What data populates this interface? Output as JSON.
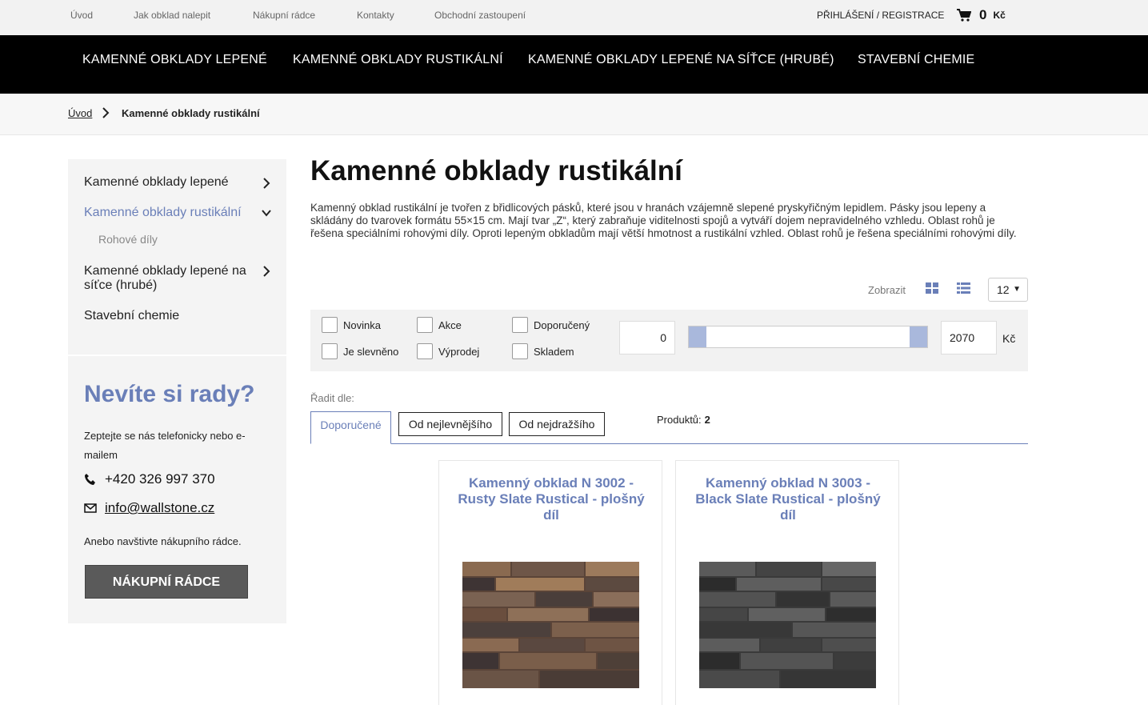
{
  "topbar": {
    "links": [
      "Úvod",
      "Jak obklad nalepit",
      "Nákupní rádce",
      "Kontakty",
      "Obchodní zastoupení"
    ],
    "login": "PŘIHLÁŠENÍ / REGISTRACE",
    "cart_amount": "0",
    "cart_currency": "Kč"
  },
  "nav": {
    "items": [
      "KAMENNÉ OBKLADY LEPENÉ",
      "KAMENNÉ OBKLADY RUSTIKÁLNÍ",
      "KAMENNÉ OBKLADY LEPENÉ NA SÍŤCE (HRUBÉ)",
      "STAVEBNÍ CHEMIE"
    ]
  },
  "breadcrumb": {
    "home": "Úvod",
    "current": "Kamenné obklady rustikální"
  },
  "sidebar": {
    "categories": [
      {
        "label": "Kamenné obklady lepené"
      },
      {
        "label": "Kamenné obklady rustikální",
        "active": true
      },
      {
        "label": "Rohové díly",
        "sub": true
      },
      {
        "label": "Kamenné obklady lepené na síťce (hrubé)"
      },
      {
        "label": "Stavební chemie"
      }
    ],
    "help": {
      "title": "Nevíte si rady?",
      "text": "Zeptejte se nás telefonicky nebo e-mailem",
      "phone": "+420 326 997 370",
      "email": "info@wallstone.cz",
      "visit": "Anebo navštivte nákupního rádce.",
      "button": "NÁKUPNÍ RÁDCE"
    }
  },
  "main": {
    "title": "Kamenné obklady rustikální",
    "description": "Kamenný obklad rustikální je tvořen z břidlicových pásků, které jsou v hranách vzájemně slepené pryskyřičným lepidlem. Pásky jsou lepeny a skládány do tvarovek formátu 55×15 cm. Mají tvar „Z“, který zabraňuje viditelnosti spojů a vytváří dojem nepravidelného vzhledu. Oblast rohů je řešena speciálními rohovými díly. Oproti lepeným obkladům mají větší hmotnost a rustikální vzhled. Oblast rohů je řešena speciálními rohovými díly.",
    "view_label": "Zobrazit",
    "per_page": "12",
    "filters": {
      "checkboxes": [
        "Novinka",
        "Akce",
        "Doporučený",
        "Je slevněno",
        "Výprodej",
        "Skladem"
      ],
      "price_min": "0",
      "price_max": "2070",
      "currency": "Kč"
    },
    "sort": {
      "label": "Řadit dle:",
      "tabs": [
        "Doporučené",
        "Od nejlevnějšího",
        "Od nejdražšího"
      ],
      "count_label": "Produktů:",
      "count": "2"
    },
    "products": [
      {
        "title": "Kamenný obklad N 3002 - Rusty Slate Rustical - plošný díl"
      },
      {
        "title": "Kamenný obklad N 3003 - Black Slate Rustical - plošný díl"
      }
    ]
  },
  "colors": {
    "accent": "#6a7fb8",
    "nav_bg": "#000000",
    "button_bg": "#5a5a5a"
  }
}
